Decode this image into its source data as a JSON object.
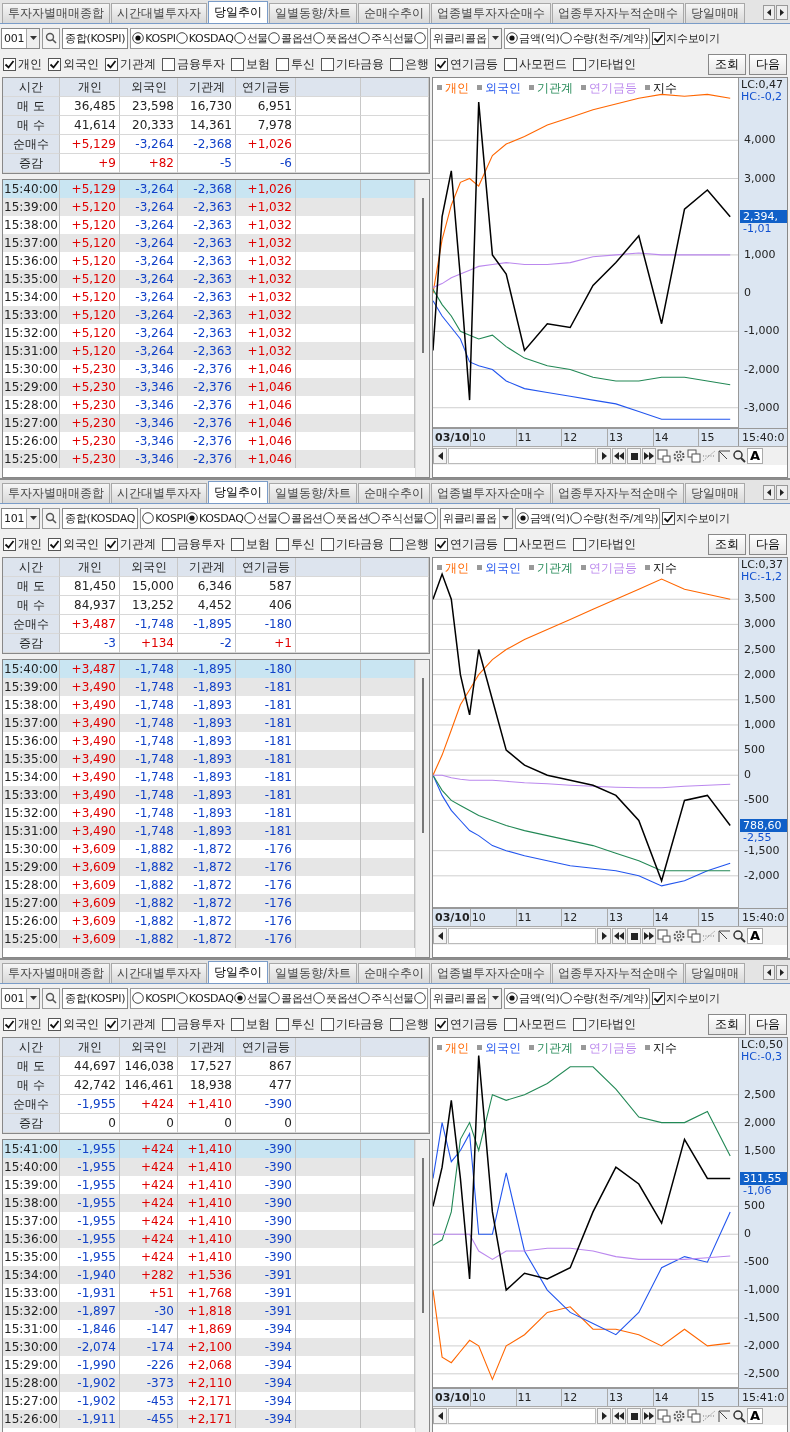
{
  "panels": [
    {
      "tabs": [
        {
          "label": "투자자별매매종합",
          "selected": false
        },
        {
          "label": "시간대별투자자",
          "selected": false
        },
        {
          "label": "당일추이",
          "selected": true
        },
        {
          "label": "일별동향/차트",
          "selected": false
        },
        {
          "label": "순매수추이",
          "selected": false
        },
        {
          "label": "업종별투자자순매수",
          "selected": false
        },
        {
          "label": "업종투자자누적순매수",
          "selected": false
        },
        {
          "label": "당일매매",
          "selected": false
        }
      ],
      "code": "001",
      "market_name": "종합(KOSPI)",
      "markets": [
        {
          "label": "KOSPI",
          "selected": true
        },
        {
          "label": "KOSDAQ",
          "selected": false
        },
        {
          "label": "선물",
          "selected": false
        },
        {
          "label": "콜옵션",
          "selected": false
        },
        {
          "label": "풋옵션",
          "selected": false
        },
        {
          "label": "주식선물",
          "selected": false
        },
        {
          "selected": false
        }
      ],
      "weekly_option": "위클리콜옵",
      "units": [
        {
          "label": "금액(억)",
          "selected": true
        },
        {
          "label": "수량(천주/계약)",
          "selected": false
        }
      ],
      "show_index": {
        "label": "지수보이기",
        "checked": true
      },
      "investors": [
        {
          "label": "개인",
          "checked": true
        },
        {
          "label": "외국인",
          "checked": true
        },
        {
          "label": "기관계",
          "checked": true
        },
        {
          "label": "금융투자",
          "checked": false
        },
        {
          "label": "보험",
          "checked": false
        },
        {
          "label": "투신",
          "checked": false
        },
        {
          "label": "기타금융",
          "checked": false
        },
        {
          "label": "은행",
          "checked": false
        },
        {
          "label": "연기금등",
          "checked": true
        },
        {
          "label": "사모펀드",
          "checked": false
        },
        {
          "label": "기타법인",
          "checked": false
        }
      ],
      "buttons": [
        "조회",
        "다음"
      ],
      "summary": {
        "columns": [
          "시간",
          "개인",
          "외국인",
          "기관계",
          "연기금등"
        ],
        "rows": [
          {
            "label": "매 도",
            "values": [
              "36,485",
              "23,598",
              "16,730",
              "6,951"
            ]
          },
          {
            "label": "매 수",
            "values": [
              "41,614",
              "20,333",
              "14,361",
              "7,978"
            ]
          },
          {
            "label": "순매수",
            "values": [
              "+5,129",
              "-3,264",
              "-2,368",
              "+1,026"
            ]
          },
          {
            "label": "증감",
            "values": [
              "+9",
              "+82",
              "-5",
              "-6"
            ]
          }
        ]
      },
      "minute_rows": [
        {
          "time": "15:40:00",
          "values": [
            "+5,129",
            "-3,264",
            "-2,368",
            "+1,026"
          ],
          "selected": true
        },
        {
          "time": "15:39:00",
          "values": [
            "+5,120",
            "-3,264",
            "-2,363",
            "+1,032"
          ],
          "selected": false
        },
        {
          "time": "15:38:00",
          "values": [
            "+5,120",
            "-3,264",
            "-2,363",
            "+1,032"
          ],
          "selected": false
        },
        {
          "time": "15:37:00",
          "values": [
            "+5,120",
            "-3,264",
            "-2,363",
            "+1,032"
          ],
          "selected": false
        },
        {
          "time": "15:36:00",
          "values": [
            "+5,120",
            "-3,264",
            "-2,363",
            "+1,032"
          ],
          "selected": false
        },
        {
          "time": "15:35:00",
          "values": [
            "+5,120",
            "-3,264",
            "-2,363",
            "+1,032"
          ],
          "selected": false
        },
        {
          "time": "15:34:00",
          "values": [
            "+5,120",
            "-3,264",
            "-2,363",
            "+1,032"
          ],
          "selected": false
        },
        {
          "time": "15:33:00",
          "values": [
            "+5,120",
            "-3,264",
            "-2,363",
            "+1,032"
          ],
          "selected": false
        },
        {
          "time": "15:32:00",
          "values": [
            "+5,120",
            "-3,264",
            "-2,363",
            "+1,032"
          ],
          "selected": false
        },
        {
          "time": "15:31:00",
          "values": [
            "+5,120",
            "-3,264",
            "-2,363",
            "+1,032"
          ],
          "selected": false
        },
        {
          "time": "15:30:00",
          "values": [
            "+5,230",
            "-3,346",
            "-2,376",
            "+1,046"
          ],
          "selected": false
        },
        {
          "time": "15:29:00",
          "values": [
            "+5,230",
            "-3,346",
            "-2,376",
            "+1,046"
          ],
          "selected": false
        },
        {
          "time": "15:28:00",
          "values": [
            "+5,230",
            "-3,346",
            "-2,376",
            "+1,046"
          ],
          "selected": false
        },
        {
          "time": "15:27:00",
          "values": [
            "+5,230",
            "-3,346",
            "-2,376",
            "+1,046"
          ],
          "selected": false
        },
        {
          "time": "15:26:00",
          "values": [
            "+5,230",
            "-3,346",
            "-2,376",
            "+1,046"
          ],
          "selected": false
        },
        {
          "time": "15:25:00",
          "values": [
            "+5,230",
            "-3,346",
            "-2,376",
            "+1,046"
          ],
          "selected": false
        }
      ],
      "chart": {
        "lc": "LC:0,47",
        "hc": "HC:-0,2",
        "price_badge": "2,394,",
        "change": "-1,01",
        "date_label": "03/10",
        "time_label": "15:40:0",
        "font_button": "A",
        "chart_data": {
          "type": "line",
          "grid": true,
          "x": [
            9,
            9.2,
            9.4,
            9.6,
            9.8,
            10,
            10.3,
            10.6,
            11,
            11.5,
            12,
            12.5,
            13,
            13.5,
            14,
            14.5,
            15,
            15.5
          ],
          "xlim": [
            9,
            15.67
          ],
          "ylim": [
            -3530,
            5630
          ],
          "xticks": [
            10,
            11,
            12,
            13,
            14,
            15
          ],
          "yticks": [
            {
              "value": 4000,
              "label": "4,000"
            },
            {
              "value": 3000,
              "label": "3,000"
            },
            {
              "value": 1000,
              "label": "1,000"
            },
            {
              "value": 0,
              "label": "0"
            },
            {
              "value": -1000,
              "label": "-1,000"
            },
            {
              "value": -2000,
              "label": "-2,000"
            },
            {
              "value": -3000,
              "label": "-3,000"
            }
          ],
          "series": [
            {
              "name": "개인",
              "color": "#ff6600",
              "values": [
                0,
                1400,
                2300,
                2900,
                3000,
                2800,
                3600,
                3900,
                4100,
                4400,
                4600,
                4800,
                4950,
                5100,
                5200,
                5150,
                5200,
                5100
              ]
            },
            {
              "name": "외국인",
              "color": "#2255ee",
              "values": [
                -200,
                -600,
                -900,
                -1200,
                -1800,
                -1900,
                -2000,
                -2300,
                -2500,
                -2600,
                -2700,
                -2800,
                -2900,
                -3100,
                -3300,
                -3300,
                -3300,
                -3300
              ]
            },
            {
              "name": "기관계",
              "color": "#228855",
              "values": [
                100,
                -300,
                -600,
                -1000,
                -1100,
                -1200,
                -1100,
                -1400,
                -1700,
                -1900,
                -2000,
                -2200,
                -2300,
                -2300,
                -2200,
                -2200,
                -2300,
                -2400
              ]
            },
            {
              "name": "연기금등",
              "color": "#bb88ee",
              "values": [
                150,
                250,
                400,
                500,
                600,
                700,
                750,
                800,
                750,
                750,
                800,
                950,
                1000,
                1050,
                1000,
                1000,
                1000,
                1000
              ]
            },
            {
              "name": "지수",
              "color": "#000000",
              "values": [
                -1500,
                2000,
                3200,
                400,
                -2800,
                5000,
                1000,
                500,
                -1500,
                -800,
                -900,
                200,
                800,
                1500,
                -800,
                2200,
                2700,
                2000
              ]
            }
          ]
        }
      }
    },
    {
      "tabs": [
        {
          "label": "투자자별매매종합",
          "selected": false
        },
        {
          "label": "시간대별투자자",
          "selected": false
        },
        {
          "label": "당일추이",
          "selected": true
        },
        {
          "label": "일별동향/차트",
          "selected": false
        },
        {
          "label": "순매수추이",
          "selected": false
        },
        {
          "label": "업종별투자자순매수",
          "selected": false
        },
        {
          "label": "업종투자자누적순매수",
          "selected": false
        },
        {
          "label": "당일매매",
          "selected": false
        }
      ],
      "code": "101",
      "market_name": "종합(KOSDAQ",
      "markets": [
        {
          "label": "KOSPI",
          "selected": false
        },
        {
          "label": "KOSDAQ",
          "selected": true
        },
        {
          "label": "선물",
          "selected": false
        },
        {
          "label": "콜옵션",
          "selected": false
        },
        {
          "label": "풋옵션",
          "selected": false
        },
        {
          "label": "주식선물",
          "selected": false
        },
        {
          "selected": false
        }
      ],
      "weekly_option": "위클리콜옵",
      "units": [
        {
          "label": "금액(억)",
          "selected": true
        },
        {
          "label": "수량(천주/계약)",
          "selected": false
        }
      ],
      "show_index": {
        "label": "지수보이기",
        "checked": true
      },
      "investors": [
        {
          "label": "개인",
          "checked": true
        },
        {
          "label": "외국인",
          "checked": true
        },
        {
          "label": "기관계",
          "checked": true
        },
        {
          "label": "금융투자",
          "checked": false
        },
        {
          "label": "보험",
          "checked": false
        },
        {
          "label": "투신",
          "checked": false
        },
        {
          "label": "기타금융",
          "checked": false
        },
        {
          "label": "은행",
          "checked": false
        },
        {
          "label": "연기금등",
          "checked": true
        },
        {
          "label": "사모펀드",
          "checked": false
        },
        {
          "label": "기타법인",
          "checked": false
        }
      ],
      "buttons": [
        "조회",
        "다음"
      ],
      "summary": {
        "columns": [
          "시간",
          "개인",
          "외국인",
          "기관계",
          "연기금등"
        ],
        "rows": [
          {
            "label": "매 도",
            "values": [
              "81,450",
              "15,000",
              "6,346",
              "587"
            ]
          },
          {
            "label": "매 수",
            "values": [
              "84,937",
              "13,252",
              "4,452",
              "406"
            ]
          },
          {
            "label": "순매수",
            "values": [
              "+3,487",
              "-1,748",
              "-1,895",
              "-180"
            ]
          },
          {
            "label": "증감",
            "values": [
              "-3",
              "+134",
              "-2",
              "+1"
            ]
          }
        ]
      },
      "minute_rows": [
        {
          "time": "15:40:00",
          "values": [
            "+3,487",
            "-1,748",
            "-1,895",
            "-180"
          ],
          "selected": true
        },
        {
          "time": "15:39:00",
          "values": [
            "+3,490",
            "-1,748",
            "-1,893",
            "-181"
          ],
          "selected": false
        },
        {
          "time": "15:38:00",
          "values": [
            "+3,490",
            "-1,748",
            "-1,893",
            "-181"
          ],
          "selected": false
        },
        {
          "time": "15:37:00",
          "values": [
            "+3,490",
            "-1,748",
            "-1,893",
            "-181"
          ],
          "selected": false
        },
        {
          "time": "15:36:00",
          "values": [
            "+3,490",
            "-1,748",
            "-1,893",
            "-181"
          ],
          "selected": false
        },
        {
          "time": "15:35:00",
          "values": [
            "+3,490",
            "-1,748",
            "-1,893",
            "-181"
          ],
          "selected": false
        },
        {
          "time": "15:34:00",
          "values": [
            "+3,490",
            "-1,748",
            "-1,893",
            "-181"
          ],
          "selected": false
        },
        {
          "time": "15:33:00",
          "values": [
            "+3,490",
            "-1,748",
            "-1,893",
            "-181"
          ],
          "selected": false
        },
        {
          "time": "15:32:00",
          "values": [
            "+3,490",
            "-1,748",
            "-1,893",
            "-181"
          ],
          "selected": false
        },
        {
          "time": "15:31:00",
          "values": [
            "+3,490",
            "-1,748",
            "-1,893",
            "-181"
          ],
          "selected": false
        },
        {
          "time": "15:30:00",
          "values": [
            "+3,609",
            "-1,882",
            "-1,872",
            "-176"
          ],
          "selected": false
        },
        {
          "time": "15:29:00",
          "values": [
            "+3,609",
            "-1,882",
            "-1,872",
            "-176"
          ],
          "selected": false
        },
        {
          "time": "15:28:00",
          "values": [
            "+3,609",
            "-1,882",
            "-1,872",
            "-176"
          ],
          "selected": false
        },
        {
          "time": "15:27:00",
          "values": [
            "+3,609",
            "-1,882",
            "-1,872",
            "-176"
          ],
          "selected": false
        },
        {
          "time": "15:26:00",
          "values": [
            "+3,609",
            "-1,882",
            "-1,872",
            "-176"
          ],
          "selected": false
        },
        {
          "time": "15:25:00",
          "values": [
            "+3,609",
            "-1,882",
            "-1,872",
            "-176"
          ],
          "selected": false
        }
      ],
      "chart": {
        "lc": "LC:0,37",
        "hc": "HC:-1,2",
        "price_badge": "788,60",
        "change": "-2,55",
        "date_label": "03/10",
        "time_label": "15:40:0",
        "font_button": "A",
        "chart_data": {
          "type": "line",
          "grid": true,
          "x": [
            9,
            9.2,
            9.4,
            9.6,
            9.8,
            10,
            10.3,
            10.6,
            11,
            11.5,
            12,
            12.5,
            13,
            13.5,
            14,
            14.5,
            15,
            15.5
          ],
          "xlim": [
            9,
            15.67
          ],
          "ylim": [
            -2640,
            4320
          ],
          "xticks": [
            10,
            11,
            12,
            13,
            14,
            15
          ],
          "yticks": [
            {
              "value": 3500,
              "label": "3,500"
            },
            {
              "value": 3000,
              "label": "3,000"
            },
            {
              "value": 2500,
              "label": "2,500"
            },
            {
              "value": 2000,
              "label": "2,000"
            },
            {
              "value": 1500,
              "label": "1,500"
            },
            {
              "value": 1000,
              "label": "1,000"
            },
            {
              "value": 500,
              "label": "500"
            },
            {
              "value": 0,
              "label": "0"
            },
            {
              "value": -500,
              "label": "-500"
            },
            {
              "value": -1500,
              "label": "-1,500"
            },
            {
              "value": -2000,
              "label": "-2,000"
            }
          ],
          "series": [
            {
              "name": "개인",
              "color": "#ff6600",
              "values": [
                0,
                400,
                900,
                1400,
                1700,
                2000,
                2300,
                2500,
                2700,
                2900,
                3100,
                3300,
                3500,
                3700,
                3900,
                3700,
                3600,
                3500
              ]
            },
            {
              "name": "외국인",
              "color": "#2255ee",
              "values": [
                0,
                -400,
                -700,
                -900,
                -1100,
                -1200,
                -1400,
                -1500,
                -1600,
                -1700,
                -1800,
                -1850,
                -1900,
                -2000,
                -2200,
                -2100,
                -1900,
                -1750
              ]
            },
            {
              "name": "기관계",
              "color": "#228855",
              "values": [
                0,
                -300,
                -500,
                -600,
                -700,
                -800,
                -900,
                -1000,
                -1100,
                -1200,
                -1300,
                -1400,
                -1550,
                -1700,
                -1900,
                -1900,
                -1900,
                -1900
              ]
            },
            {
              "name": "연기금등",
              "color": "#bb88ee",
              "values": [
                0,
                0,
                -50,
                -80,
                -100,
                -100,
                -100,
                -120,
                -150,
                -170,
                -200,
                -220,
                -240,
                -250,
                -250,
                -220,
                -200,
                -180
              ]
            },
            {
              "name": "지수",
              "color": "#000000",
              "values": [
                3500,
                4000,
                3500,
                2000,
                1200,
                2500,
                1500,
                500,
                200,
                0,
                -100,
                -200,
                -400,
                -900,
                -2100,
                -500,
                -400,
                -1000
              ]
            }
          ]
        }
      }
    },
    {
      "tabs": [
        {
          "label": "투자자별매매종합",
          "selected": false
        },
        {
          "label": "시간대별투자자",
          "selected": false
        },
        {
          "label": "당일추이",
          "selected": true
        },
        {
          "label": "일별동향/차트",
          "selected": false
        },
        {
          "label": "순매수추이",
          "selected": false
        },
        {
          "label": "업종별투자자순매수",
          "selected": false
        },
        {
          "label": "업종투자자누적순매수",
          "selected": false
        },
        {
          "label": "당일매매",
          "selected": false
        }
      ],
      "code": "001",
      "market_name": "종합(KOSPI)",
      "markets": [
        {
          "label": "KOSPI",
          "selected": false
        },
        {
          "label": "KOSDAQ",
          "selected": false
        },
        {
          "label": "선물",
          "selected": true
        },
        {
          "label": "콜옵션",
          "selected": false
        },
        {
          "label": "풋옵션",
          "selected": false
        },
        {
          "label": "주식선물",
          "selected": false
        },
        {
          "selected": false
        }
      ],
      "weekly_option": "위클리콜옵",
      "units": [
        {
          "label": "금액(억)",
          "selected": true
        },
        {
          "label": "수량(천주/계약)",
          "selected": false
        }
      ],
      "show_index": {
        "label": "지수보이기",
        "checked": true
      },
      "investors": [
        {
          "label": "개인",
          "checked": true
        },
        {
          "label": "외국인",
          "checked": true
        },
        {
          "label": "기관계",
          "checked": true
        },
        {
          "label": "금융투자",
          "checked": false
        },
        {
          "label": "보험",
          "checked": false
        },
        {
          "label": "투신",
          "checked": false
        },
        {
          "label": "기타금융",
          "checked": false
        },
        {
          "label": "은행",
          "checked": false
        },
        {
          "label": "연기금등",
          "checked": true
        },
        {
          "label": "사모펀드",
          "checked": false
        },
        {
          "label": "기타법인",
          "checked": false
        }
      ],
      "buttons": [
        "조회",
        "다음"
      ],
      "summary": {
        "columns": [
          "시간",
          "개인",
          "외국인",
          "기관계",
          "연기금등"
        ],
        "rows": [
          {
            "label": "매 도",
            "values": [
              "44,697",
              "146,038",
              "17,527",
              "867"
            ]
          },
          {
            "label": "매 수",
            "values": [
              "42,742",
              "146,461",
              "18,938",
              "477"
            ]
          },
          {
            "label": "순매수",
            "values": [
              "-1,955",
              "+424",
              "+1,410",
              "-390"
            ]
          },
          {
            "label": "증감",
            "values": [
              "0",
              "0",
              "0",
              "0"
            ]
          }
        ]
      },
      "minute_rows": [
        {
          "time": "15:41:00",
          "values": [
            "-1,955",
            "+424",
            "+1,410",
            "-390"
          ],
          "selected": true
        },
        {
          "time": "15:40:00",
          "values": [
            "-1,955",
            "+424",
            "+1,410",
            "-390"
          ],
          "selected": false
        },
        {
          "time": "15:39:00",
          "values": [
            "-1,955",
            "+424",
            "+1,410",
            "-390"
          ],
          "selected": false
        },
        {
          "time": "15:38:00",
          "values": [
            "-1,955",
            "+424",
            "+1,410",
            "-390"
          ],
          "selected": false
        },
        {
          "time": "15:37:00",
          "values": [
            "-1,955",
            "+424",
            "+1,410",
            "-390"
          ],
          "selected": false
        },
        {
          "time": "15:36:00",
          "values": [
            "-1,955",
            "+424",
            "+1,410",
            "-390"
          ],
          "selected": false
        },
        {
          "time": "15:35:00",
          "values": [
            "-1,955",
            "+424",
            "+1,410",
            "-390"
          ],
          "selected": false
        },
        {
          "time": "15:34:00",
          "values": [
            "-1,940",
            "+282",
            "+1,536",
            "-391"
          ],
          "selected": false
        },
        {
          "time": "15:33:00",
          "values": [
            "-1,931",
            "+51",
            "+1,768",
            "-391"
          ],
          "selected": false
        },
        {
          "time": "15:32:00",
          "values": [
            "-1,897",
            "-30",
            "+1,818",
            "-391"
          ],
          "selected": false
        },
        {
          "time": "15:31:00",
          "values": [
            "-1,846",
            "-147",
            "+1,869",
            "-394"
          ],
          "selected": false
        },
        {
          "time": "15:30:00",
          "values": [
            "-2,074",
            "-174",
            "+2,100",
            "-394"
          ],
          "selected": false
        },
        {
          "time": "15:29:00",
          "values": [
            "-1,990",
            "-226",
            "+2,068",
            "-394"
          ],
          "selected": false
        },
        {
          "time": "15:28:00",
          "values": [
            "-1,902",
            "-373",
            "+2,110",
            "-394"
          ],
          "selected": false
        },
        {
          "time": "15:27:00",
          "values": [
            "-1,902",
            "-453",
            "+2,171",
            "-394"
          ],
          "selected": false
        },
        {
          "time": "15:26:00",
          "values": [
            "-1,911",
            "-455",
            "+2,171",
            "-394"
          ],
          "selected": false
        }
      ],
      "chart": {
        "lc": "LC:0,50",
        "hc": "HC:-0,3",
        "price_badge": "311,55",
        "change": "-1,06",
        "date_label": "03/10",
        "time_label": "15:41:0",
        "font_button": "A",
        "chart_data": {
          "type": "line",
          "grid": true,
          "x": [
            9,
            9.2,
            9.4,
            9.6,
            9.8,
            10,
            10.3,
            10.6,
            11,
            11.5,
            12,
            12.5,
            13,
            13.5,
            14,
            14.5,
            15,
            15.5
          ],
          "xlim": [
            9,
            15.67
          ],
          "ylim": [
            -2754,
            3515
          ],
          "xticks": [
            10,
            11,
            12,
            13,
            14,
            15
          ],
          "yticks": [
            {
              "value": 2500,
              "label": "2,500"
            },
            {
              "value": 2000,
              "label": "2,000"
            },
            {
              "value": 1500,
              "label": "1,500"
            },
            {
              "value": 500,
              "label": "500"
            },
            {
              "value": 0,
              "label": "0"
            },
            {
              "value": -500,
              "label": "-500"
            },
            {
              "value": -1000,
              "label": "-1,000"
            },
            {
              "value": -1500,
              "label": "-1,500"
            },
            {
              "value": -2000,
              "label": "-2,000"
            },
            {
              "value": -2500,
              "label": "-2,500"
            }
          ],
          "series": [
            {
              "name": "개인",
              "color": "#ff6600",
              "values": [
                -1000,
                -2200,
                -2300,
                -2100,
                -1900,
                -2000,
                -2600,
                -2000,
                -1800,
                -1400,
                -1300,
                -1700,
                -1700,
                -1800,
                -2000,
                -1700,
                -2000,
                -1950
              ]
            },
            {
              "name": "외국인",
              "color": "#2255ee",
              "values": [
                1000,
                2000,
                1300,
                1500,
                1800,
                0,
                0,
                1100,
                -300,
                -1000,
                -1400,
                -1600,
                -1800,
                -1400,
                -600,
                -400,
                -500,
                400
              ]
            },
            {
              "name": "기관계",
              "color": "#228855",
              "values": [
                -200,
                -100,
                400,
                1700,
                2000,
                1500,
                2500,
                2400,
                2500,
                2700,
                3000,
                3000,
                2600,
                2100,
                2000,
                2000,
                2200,
                1400
              ]
            },
            {
              "name": "연기금등",
              "color": "#bb88ee",
              "values": [
                0,
                0,
                0,
                0,
                0,
                -300,
                -450,
                -300,
                -300,
                -250,
                -250,
                -300,
                -400,
                -450,
                -450,
                -450,
                -420,
                -390
              ]
            },
            {
              "name": "지수",
              "color": "#000000",
              "values": [
                500,
                1200,
                2400,
                1000,
                -800,
                3200,
                400,
                -1000,
                -700,
                -800,
                -600,
                400,
                1200,
                900,
                200,
                1700,
                1000,
                1000
              ]
            }
          ]
        }
      }
    }
  ]
}
